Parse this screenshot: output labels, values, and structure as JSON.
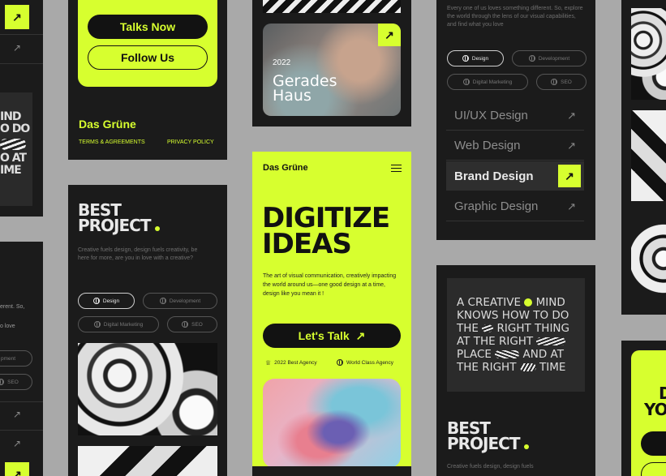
{
  "colors": {
    "accent": "#d7ff2f",
    "dark": "#1b1b1b",
    "background": "#a9a9a9"
  },
  "card_a": {
    "talks_button": "Talks Now",
    "follow_button": "Follow Us",
    "brand": "Das Grüne",
    "terms_link": "TERMS & AGREEMENTS",
    "privacy_link": "PRIVACY POLICY"
  },
  "card_b": {
    "year": "2022",
    "title_line1": "Gerades",
    "title_line2": "Haus"
  },
  "card_c": {
    "title_line1": "BEST",
    "title_line2": "PROJECT",
    "description": "Creative fuels design, design fuels creativity, be here for more, are you in love with a creative?",
    "tags": [
      "Design",
      "Development",
      "Digital Marketing",
      "SEO"
    ]
  },
  "card_main": {
    "brand": "Das Grüne",
    "headline_line1": "DIGITIZE",
    "headline_line2": "IDEAS",
    "body": "The art of visual communication, creatively impacting the world around us—one good design at a time, design like you mean it !",
    "cta": "Let's Talk",
    "badge1": "2022 Best Agency",
    "badge2": "World Class Agency"
  },
  "card_e": {
    "intro": "Every one of us loves something different. So, explore the world through the lens of our visual capabilities, and find what you love",
    "tags": [
      "Design",
      "Development",
      "Digital Marketing",
      "SEO"
    ],
    "services": [
      "UI/UX Design",
      "Web Design",
      "Brand Design",
      "Graphic Design"
    ]
  },
  "card_f": {
    "quote_lines": [
      "A CREATIVE",
      "MIND",
      "KNOWS HOW TO DO",
      "THE",
      "RIGHT THING",
      "AT",
      "THE RIGHT",
      "PLACE",
      "AND AT",
      "THE RIGHT",
      "TIME"
    ],
    "title_line1": "BEST",
    "title_line2": "PROJECT",
    "description": "Creative fuels design, design fuels"
  },
  "card_left_top": {
    "lines": [
      "IND",
      "O DO",
      "O AT",
      "IME"
    ]
  },
  "card_left_bottom": {
    "text1": "erent. So,",
    "text2": "o love",
    "tag1": "pment",
    "tag2": "SEO"
  },
  "card_right_bottom": {
    "line1": "D",
    "line2": "YO"
  }
}
